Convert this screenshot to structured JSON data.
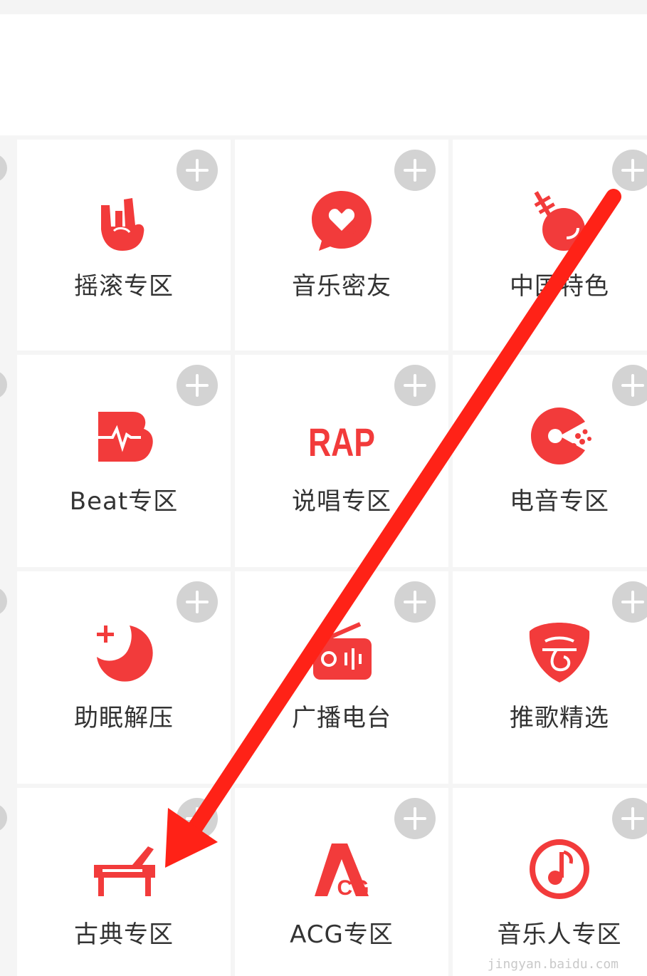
{
  "tiles": [
    {
      "label": "摇滚专区",
      "icon": "rock-hand-icon"
    },
    {
      "label": "音乐密友",
      "icon": "heart-chat-icon"
    },
    {
      "label": "中国特色",
      "icon": "pipa-instrument-icon"
    },
    {
      "label": "Beat专区",
      "icon": "beat-pulse-icon"
    },
    {
      "label": "说唱专区",
      "icon": "rap-text-icon"
    },
    {
      "label": "电音专区",
      "icon": "electronic-disc-icon"
    },
    {
      "label": "助眠解压",
      "icon": "moon-sleep-icon"
    },
    {
      "label": "广播电台",
      "icon": "radio-icon"
    },
    {
      "label": "推歌精选",
      "icon": "recommend-shield-icon"
    },
    {
      "label": "古典专区",
      "icon": "piano-icon"
    },
    {
      "label": "ACG专区",
      "icon": "acg-logo-icon"
    },
    {
      "label": "音乐人专区",
      "icon": "music-note-circle-icon"
    }
  ],
  "icons": {
    "rap_text": "RAP",
    "acg_text_a": "A",
    "acg_text_cg": "CG"
  },
  "colors": {
    "accent": "#f23b3b",
    "arrow": "#ff2217",
    "add_button": "#d3d3d3"
  },
  "watermark": "jingyan.baidu.com"
}
